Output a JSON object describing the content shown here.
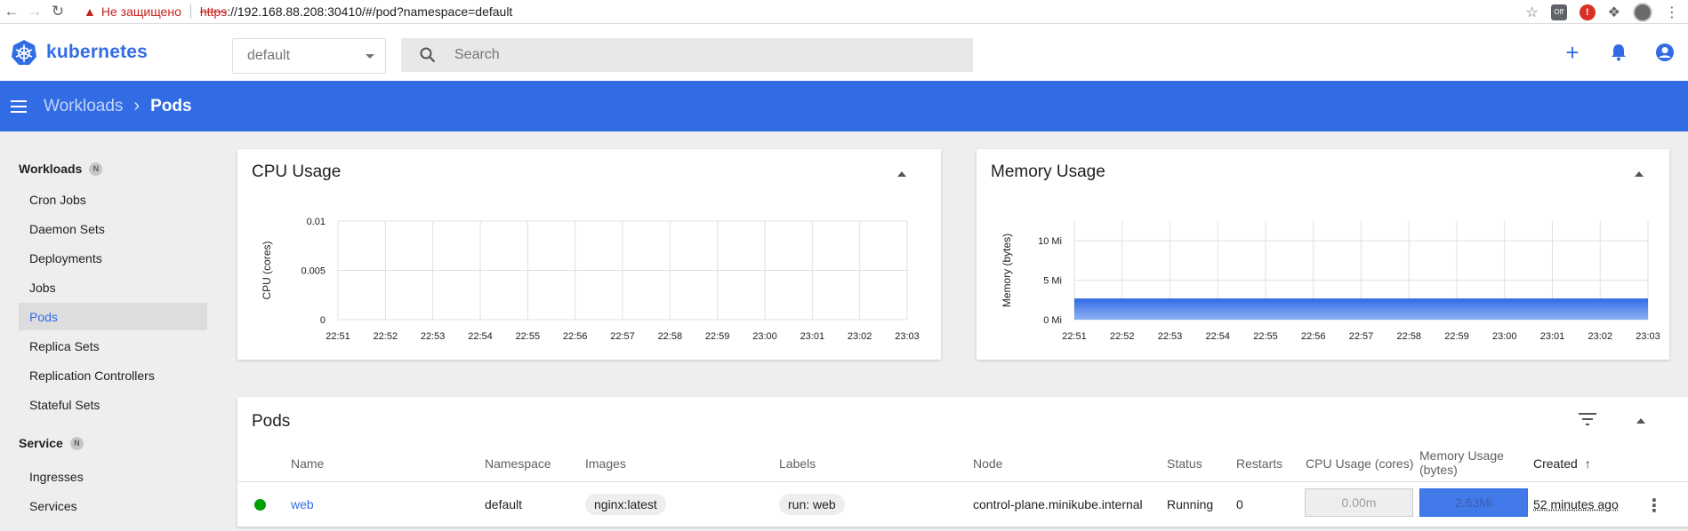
{
  "browser": {
    "security_warning": "Не защищено",
    "url_scheme": "https",
    "url_rest": "://192.168.88.208:30410/#/pod?namespace=default",
    "ext_badge": "Off"
  },
  "header": {
    "logo_text": "kubernetes",
    "namespace": "default",
    "search_placeholder": "Search",
    "accent": "#326ce5"
  },
  "toolbar": {
    "crumb_parent": "Workloads",
    "crumb_current": "Pods"
  },
  "sidebar": {
    "sections": [
      {
        "label": "Workloads",
        "badge": "N"
      },
      {
        "label": "Service",
        "badge": "N"
      }
    ],
    "workload_items": [
      "Cron Jobs",
      "Daemon Sets",
      "Deployments",
      "Jobs",
      "Pods",
      "Replica Sets",
      "Replication Controllers",
      "Stateful Sets"
    ],
    "service_items": [
      "Ingresses",
      "Services"
    ],
    "active": "Pods"
  },
  "cpu_card": {
    "title": "CPU Usage"
  },
  "memory_card": {
    "title": "Memory Usage"
  },
  "chart_data": [
    {
      "type": "line",
      "title": "CPU Usage",
      "ylabel": "CPU (cores)",
      "x": [
        "22:51",
        "22:52",
        "22:53",
        "22:54",
        "22:55",
        "22:56",
        "22:57",
        "22:58",
        "22:59",
        "23:00",
        "23:01",
        "23:02",
        "23:03"
      ],
      "yticks": [
        "0",
        "0.005",
        "0.01"
      ],
      "ylim": [
        0,
        0.01
      ],
      "series": [
        {
          "values": []
        }
      ],
      "grid": true
    },
    {
      "type": "area",
      "title": "Memory Usage",
      "ylabel": "Memory (bytes)",
      "x": [
        "22:51",
        "22:52",
        "22:53",
        "22:54",
        "22:55",
        "22:56",
        "22:57",
        "22:58",
        "22:59",
        "23:00",
        "23:01",
        "23:02",
        "23:03"
      ],
      "yticks": [
        "0 Mi",
        "5 Mi",
        "10 Mi"
      ],
      "ylim": [
        0,
        12.5
      ],
      "series": [
        {
          "values": [
            2.63,
            2.63,
            2.63,
            2.63,
            2.63,
            2.63,
            2.63,
            2.63,
            2.63,
            2.63,
            2.63,
            2.63,
            2.63
          ]
        }
      ],
      "grid": true
    }
  ],
  "pods": {
    "title": "Pods",
    "columns": [
      "Name",
      "Namespace",
      "Images",
      "Labels",
      "Node",
      "Status",
      "Restarts",
      "CPU Usage (cores)",
      "Memory Usage",
      "(bytes)",
      "Created"
    ],
    "rows": [
      {
        "name": "web",
        "namespace": "default",
        "image": "nginx:latest",
        "label": "run: web",
        "node": "control-plane.minikube.internal",
        "status": "Running",
        "restarts": "0",
        "cpu": "0.00m",
        "memory": "2.63Mi",
        "memory_fraction": 1.0,
        "created": "52 minutes ago"
      }
    ]
  }
}
